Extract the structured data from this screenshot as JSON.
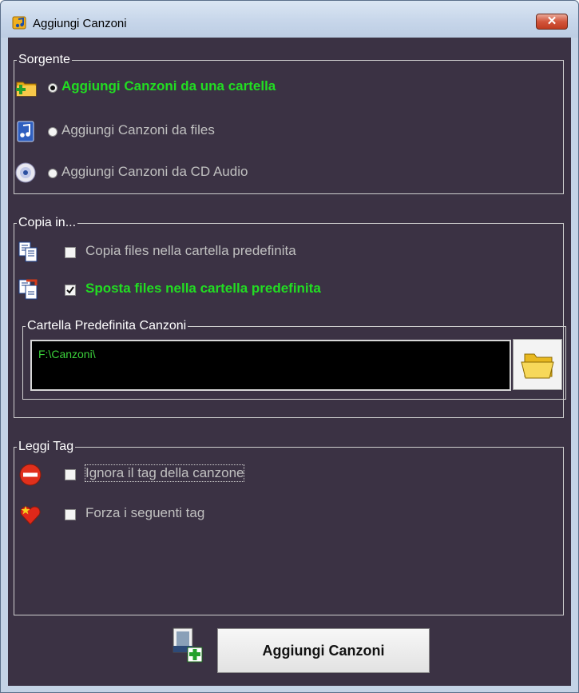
{
  "window": {
    "title": "Aggiungi Canzoni",
    "close_glyph": "✕"
  },
  "source": {
    "legend": "Sorgente",
    "options": [
      {
        "label": "Aggiungi Canzoni da una cartella",
        "selected": true,
        "icon": "folder-add-icon"
      },
      {
        "label": "Aggiungi Canzoni da files",
        "selected": false,
        "icon": "music-file-icon"
      },
      {
        "label": "Aggiungi Canzoni da CD Audio",
        "selected": false,
        "icon": "cd-icon"
      }
    ]
  },
  "copy": {
    "legend": "Copia in...",
    "options": [
      {
        "label": "Copia files nella cartella predefinita",
        "checked": false,
        "icon": "copy-files-icon"
      },
      {
        "label": "Sposta files nella cartella predefinita",
        "checked": true,
        "icon": "move-files-icon"
      }
    ],
    "folder_group": {
      "legend": "Cartella Predefinita Canzoni",
      "path": "F:\\Canzoni\\"
    }
  },
  "tags": {
    "legend": "Leggi Tag",
    "options": [
      {
        "label": "Ignora il tag della canzone",
        "checked": false,
        "icon": "no-entry-icon"
      },
      {
        "label": "Forza i seguenti tag",
        "checked": false,
        "icon": "heart-star-icon"
      }
    ]
  },
  "actions": {
    "add_label": "Aggiungi Canzoni"
  },
  "colors": {
    "background": "#3b3244",
    "active_text": "#22dd22",
    "inactive_text": "#c0c0c0",
    "path_text": "#3bd23b"
  }
}
